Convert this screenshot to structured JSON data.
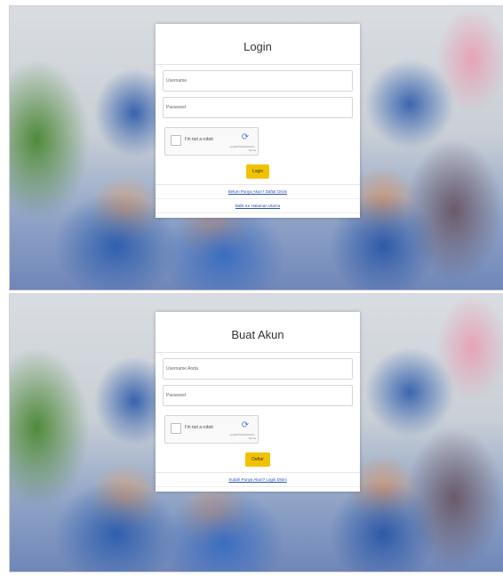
{
  "login": {
    "title": "Login",
    "username_placeholder": "Username",
    "password_placeholder": "Password",
    "captcha_label": "I'm not a robot",
    "captcha_brand": "reCAPTCHA\nPrivacy - Terms",
    "submit_label": "Login",
    "link_register": "Belum Punya Akun? Daftar Disini",
    "link_home": "Balik Ke Halaman Utama"
  },
  "register": {
    "title": "Buat Akun",
    "username_placeholder": "Username Anda",
    "password_placeholder": "Password",
    "captcha_label": "I'm not a robot",
    "captcha_brand": "reCAPTCHA\nPrivacy - Terms",
    "submit_label": "Daftar",
    "link_login": "Sudah Punya Akun? Login Disini"
  },
  "colors": {
    "accent_button": "#f2c200",
    "link": "#2a4fb0"
  },
  "icons": {
    "captcha": "recaptcha-icon"
  }
}
